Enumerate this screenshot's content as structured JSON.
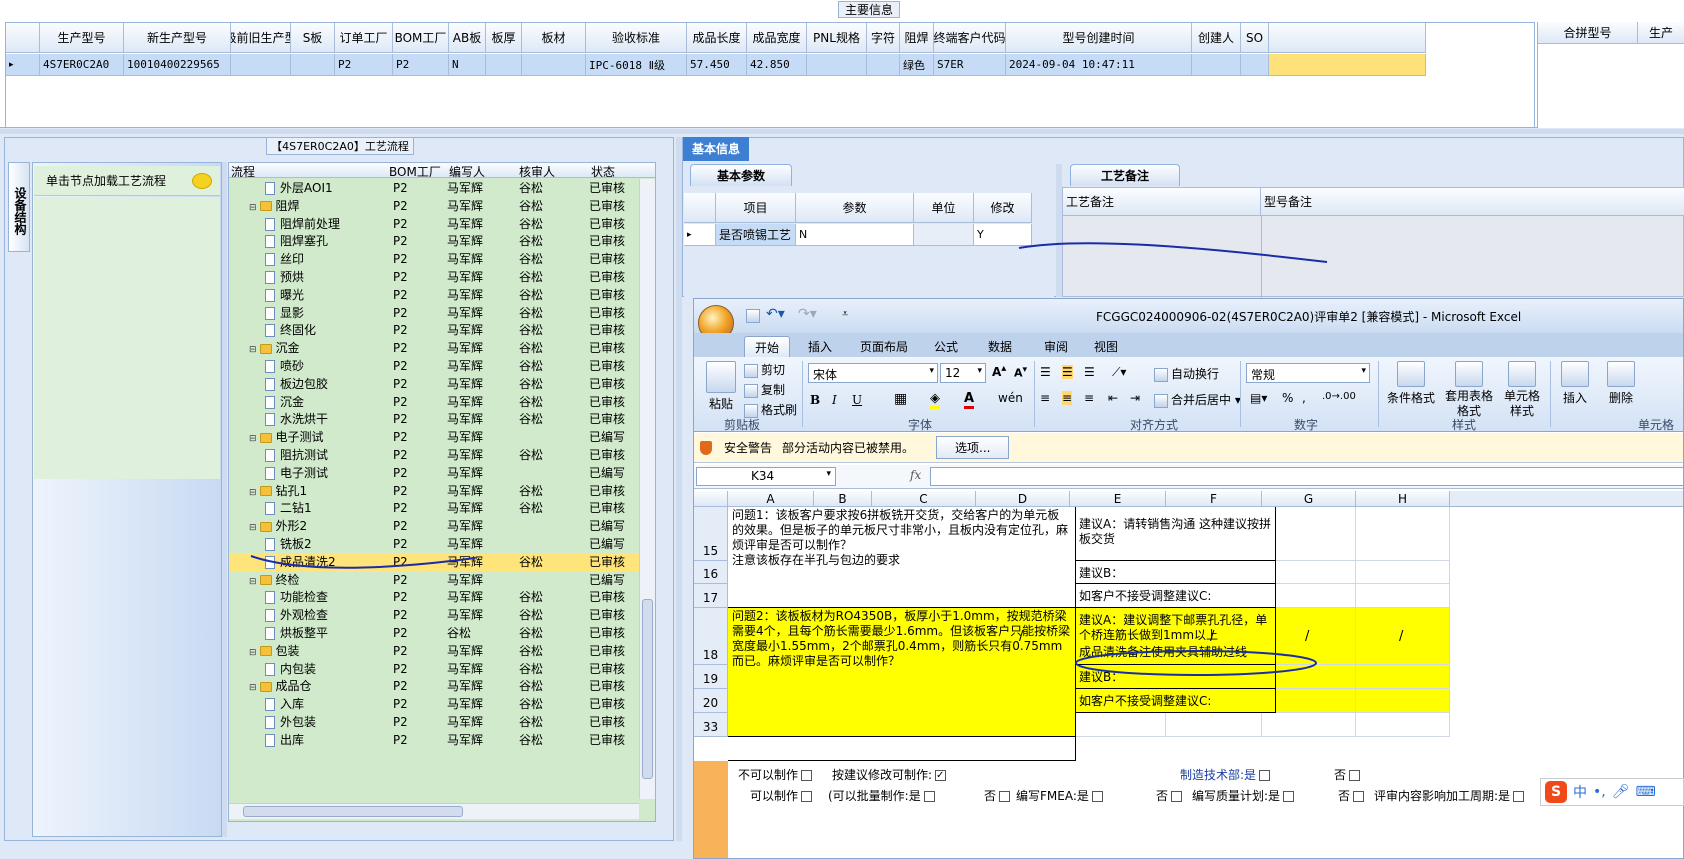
{
  "main_info": {
    "title": "主要信息",
    "columns": [
      "生产型号",
      "新生产型号",
      "升级前旧生产型号",
      "S板",
      "订单工厂",
      "BOM工厂",
      "AB板",
      "板厚",
      "板材",
      "验收标准",
      "成品长度",
      "成品宽度",
      "PNL规格",
      "字符",
      "阻焊",
      "终端客户代码",
      "型号创建时间",
      "创建人",
      "SO"
    ],
    "row": [
      "4S7ER0C2A0",
      "10010400229565",
      "",
      "",
      "P2",
      "P2",
      "N",
      "",
      "",
      "IPC-6018 Ⅱ级",
      "57.450",
      "42.850",
      "",
      "",
      "绿色",
      "S7ER",
      "2024-09-04 10:47:11",
      "",
      ""
    ],
    "right_columns": [
      "合拼型号",
      "生产"
    ]
  },
  "flow": {
    "title": "【4S7ER0C2A0】工艺流程",
    "side_tab": "设备结构",
    "hint": "单击节点加载工艺流程",
    "columns": [
      "流程",
      "BOM工厂",
      "编写人",
      "核审人",
      "状态"
    ],
    "rows": [
      {
        "n": "外层AOI1",
        "t": "d",
        "b": "P2",
        "w": "马军辉",
        "r": "谷松",
        "s": "已审核"
      },
      {
        "n": "阻焊",
        "t": "f",
        "b": "P2",
        "w": "马军辉",
        "r": "谷松",
        "s": "已审核"
      },
      {
        "n": "阻焊前处理",
        "t": "d",
        "b": "P2",
        "w": "马军辉",
        "r": "谷松",
        "s": "已审核"
      },
      {
        "n": "阻焊塞孔",
        "t": "d",
        "b": "P2",
        "w": "马军辉",
        "r": "谷松",
        "s": "已审核"
      },
      {
        "n": "丝印",
        "t": "d",
        "b": "P2",
        "w": "马军辉",
        "r": "谷松",
        "s": "已审核"
      },
      {
        "n": "预烘",
        "t": "d",
        "b": "P2",
        "w": "马军辉",
        "r": "谷松",
        "s": "已审核"
      },
      {
        "n": "曝光",
        "t": "d",
        "b": "P2",
        "w": "马军辉",
        "r": "谷松",
        "s": "已审核"
      },
      {
        "n": "显影",
        "t": "d",
        "b": "P2",
        "w": "马军辉",
        "r": "谷松",
        "s": "已审核"
      },
      {
        "n": "终固化",
        "t": "d",
        "b": "P2",
        "w": "马军辉",
        "r": "谷松",
        "s": "已审核"
      },
      {
        "n": "沉金",
        "t": "f",
        "b": "P2",
        "w": "马军辉",
        "r": "谷松",
        "s": "已审核"
      },
      {
        "n": "喷砂",
        "t": "d",
        "b": "P2",
        "w": "马军辉",
        "r": "谷松",
        "s": "已审核"
      },
      {
        "n": "板边包胶",
        "t": "d",
        "b": "P2",
        "w": "马军辉",
        "r": "谷松",
        "s": "已审核"
      },
      {
        "n": "沉金",
        "t": "d",
        "b": "P2",
        "w": "马军辉",
        "r": "谷松",
        "s": "已审核"
      },
      {
        "n": "水洗烘干",
        "t": "d",
        "b": "P2",
        "w": "马军辉",
        "r": "谷松",
        "s": "已审核"
      },
      {
        "n": "电子测试",
        "t": "f",
        "b": "P2",
        "w": "马军辉",
        "r": "",
        "s": "已编写"
      },
      {
        "n": "阻抗测试",
        "t": "d",
        "b": "P2",
        "w": "马军辉",
        "r": "谷松",
        "s": "已审核"
      },
      {
        "n": "电子测试",
        "t": "d",
        "b": "P2",
        "w": "马军辉",
        "r": "",
        "s": "已编写"
      },
      {
        "n": "钻孔1",
        "t": "f",
        "b": "P2",
        "w": "马军辉",
        "r": "谷松",
        "s": "已审核"
      },
      {
        "n": "二钻1",
        "t": "d",
        "b": "P2",
        "w": "马军辉",
        "r": "谷松",
        "s": "已审核"
      },
      {
        "n": "外形2",
        "t": "f",
        "b": "P2",
        "w": "马军辉",
        "r": "",
        "s": "已编写"
      },
      {
        "n": "铣板2",
        "t": "d",
        "b": "P2",
        "w": "马军辉",
        "r": "",
        "s": "已编写"
      },
      {
        "n": "成品清洗2",
        "t": "d",
        "b": "P2",
        "w": "马军辉",
        "r": "谷松",
        "s": "已审核",
        "sel": true
      },
      {
        "n": "终检",
        "t": "f",
        "b": "P2",
        "w": "马军辉",
        "r": "",
        "s": "已编写"
      },
      {
        "n": "功能检查",
        "t": "d",
        "b": "P2",
        "w": "马军辉",
        "r": "谷松",
        "s": "已审核"
      },
      {
        "n": "外观检查",
        "t": "d",
        "b": "P2",
        "w": "马军辉",
        "r": "谷松",
        "s": "已审核"
      },
      {
        "n": "烘板整平",
        "t": "d",
        "b": "P2",
        "w": "谷松",
        "r": "谷松",
        "s": "已审核"
      },
      {
        "n": "包装",
        "t": "f",
        "b": "P2",
        "w": "马军辉",
        "r": "谷松",
        "s": "已审核"
      },
      {
        "n": "内包装",
        "t": "d",
        "b": "P2",
        "w": "马军辉",
        "r": "谷松",
        "s": "已审核"
      },
      {
        "n": "成品仓",
        "t": "f",
        "b": "P2",
        "w": "马军辉",
        "r": "谷松",
        "s": "已审核"
      },
      {
        "n": "入库",
        "t": "d",
        "b": "P2",
        "w": "马军辉",
        "r": "谷松",
        "s": "已审核"
      },
      {
        "n": "外包装",
        "t": "d",
        "b": "P2",
        "w": "马军辉",
        "r": "谷松",
        "s": "已审核"
      },
      {
        "n": "出库",
        "t": "d",
        "b": "P2",
        "w": "马军辉",
        "r": "谷松",
        "s": "已审核"
      }
    ]
  },
  "basic": {
    "tab": "基本信息",
    "params_tab": "基本参数",
    "remark_tab": "工艺备注",
    "columns": [
      "项目",
      "参数",
      "单位",
      "修改"
    ],
    "row": [
      "是否喷锡工艺",
      "N",
      "",
      "Y"
    ],
    "remark_columns": [
      "工艺备注",
      "型号备注"
    ]
  },
  "excel": {
    "title": "FCGGC024000906-02(4S7ER0C2A0)评审单2  [兼容模式] - Microsoft Excel",
    "tabs": [
      "开始",
      "插入",
      "页面布局",
      "公式",
      "数据",
      "审阅",
      "视图"
    ],
    "clipboard": {
      "paste": "粘贴",
      "cut": "剪切",
      "copy": "复制",
      "format_painter": "格式刷",
      "group": "剪贴板"
    },
    "font": {
      "name": "宋体",
      "size": "12",
      "group": "字体"
    },
    "align": {
      "wrap": "自动换行",
      "merge": "合并后居中",
      "group": "对齐方式"
    },
    "number": {
      "format": "常规",
      "group": "数字"
    },
    "styles": {
      "cond": "条件格式",
      "table": "套用表格格式",
      "cell": "单元格样式",
      "group": "样式"
    },
    "cells": {
      "insert": "插入",
      "delete": "删除",
      "group": "单元格"
    },
    "security": {
      "label": "安全警告",
      "msg": "部分活动内容已被禁用。",
      "options": "选项..."
    },
    "name_box": "K34",
    "fx": "fx",
    "col_headers": [
      "A",
      "B",
      "C",
      "D",
      "E",
      "F",
      "G",
      "H"
    ],
    "row_nums": [
      "15",
      "16",
      "17",
      "18",
      "19",
      "20",
      "33"
    ],
    "q1": "问题1：该板客户要求按6拼板铣开交货，交给客户的为单元板的效果。但是板子的单元板尺寸非常小，且板内没有定位孔，麻烦评审是否可以制作？\n注意该板存在半孔与包边的要求",
    "q1a": "建议A：请转销售沟通 这种建议按拼板交货",
    "q1b": "建议B：",
    "q1c": "如客户不接受调整建议C:",
    "q2": "问题2：该板板材为RO4350B，板厚小于1.0mm，按规范桥梁需要4个，且每个筋长需要最少1.6mm。但该板客户只能按桥梁宽度最小1.55mm，2个邮票孔0.4mm，则筋长只有0.75mm而已。麻烦评审是否可以制作？",
    "q2a": "建议A：建议调整下邮票孔孔径，单个桥连筋长做到1mm以上",
    "q2a2": "成品清洗备注使用夹具辅助过线",
    "q2b": "建议B：",
    "q2c": "如客户不接受调整建议C:",
    "slash": "/",
    "line1_a": "不可以制作",
    "line1_b": "按建议修改可制作:",
    "line1_c": "制造技术部:是",
    "line1_d": "否",
    "line2_a": "可以制作",
    "line2_b": "(可以批量制作:是",
    "line2_c": "否",
    "line2_d": "编写FMEA:是",
    "line2_e": "否",
    "line2_f": "编写质量计划:是",
    "line2_g": "否",
    "line2_h": "评审内容影响加工周期:是",
    "ime": "中"
  }
}
